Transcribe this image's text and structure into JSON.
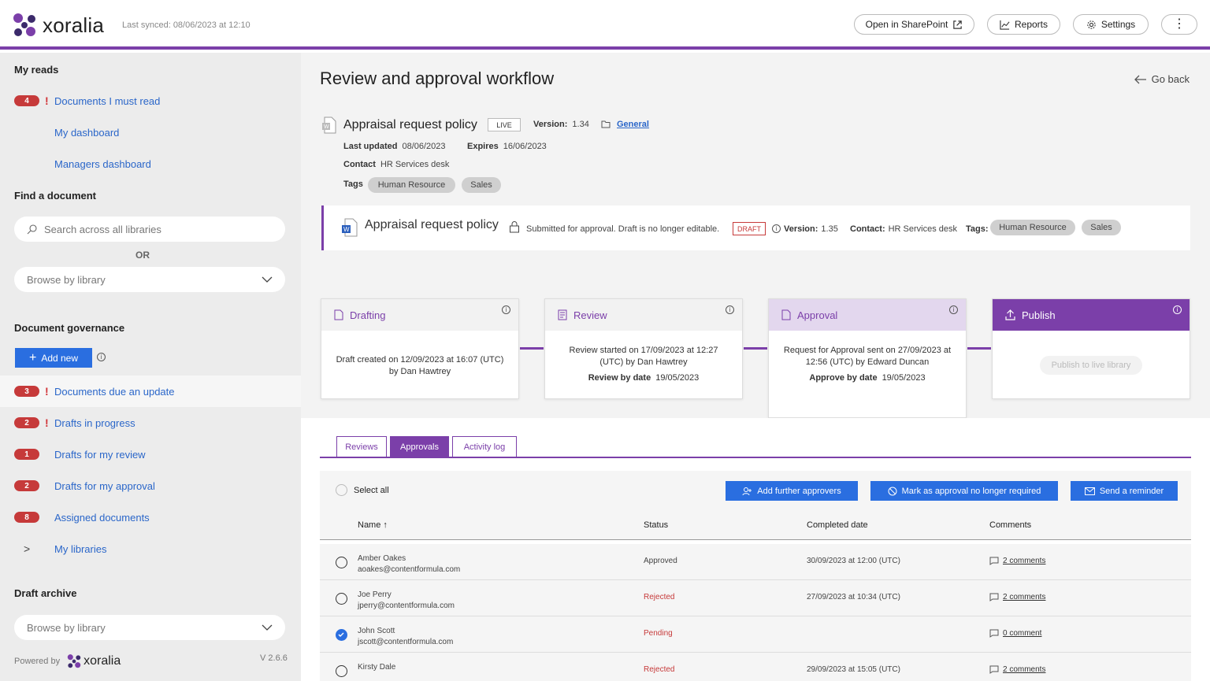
{
  "header": {
    "brand": "xoralia",
    "last_synced": "Last synced: 08/06/2023 at 12:10",
    "open_sharepoint": "Open in SharePoint",
    "reports": "Reports",
    "settings": "Settings"
  },
  "sidebar": {
    "my_reads_title": "My reads",
    "my_reads": [
      {
        "count": "4",
        "urgent": true,
        "label": "Documents I must read"
      },
      {
        "count": "",
        "urgent": false,
        "label": "My dashboard"
      },
      {
        "count": "",
        "urgent": false,
        "label": "Managers dashboard"
      }
    ],
    "find_title": "Find a document",
    "search_placeholder": "Search across all libraries",
    "or_text": "OR",
    "browse_label": "Browse by library",
    "governance_title": "Document governance",
    "add_new": "Add new",
    "governance_items": [
      {
        "count": "3",
        "urgent": true,
        "label": "Documents due an update"
      },
      {
        "count": "2",
        "urgent": true,
        "label": "Drafts in progress"
      },
      {
        "count": "1",
        "urgent": false,
        "label": "Drafts for my review"
      },
      {
        "count": "2",
        "urgent": false,
        "label": "Drafts for my approval"
      },
      {
        "count": "8",
        "urgent": false,
        "label": "Assigned documents"
      },
      {
        "count": "",
        "urgent": false,
        "label": "My libraries"
      }
    ],
    "archive_title": "Draft archive",
    "archive_browse": "Browse by library",
    "powered_by": "Powered by",
    "powered_brand": "xoralia",
    "version": "V 2.6.6"
  },
  "main": {
    "title": "Review and approval workflow",
    "go_back": "Go back",
    "doc": {
      "title": "Appraisal request policy",
      "status": "LIVE",
      "version_label": "Version:",
      "version": "1.34",
      "folder": "General",
      "last_updated_label": "Last updated",
      "last_updated": "08/06/2023",
      "expires_label": "Expires",
      "expires": "16/06/2023",
      "contact_label": "Contact",
      "contact": "HR Services desk",
      "tags_label": "Tags",
      "tags": [
        "Human Resource",
        "Sales"
      ]
    },
    "draft": {
      "title": "Appraisal request policy",
      "note": "Submitted for approval. Draft is no longer editable.",
      "status": "DRAFT",
      "version_label": "Version:",
      "version": "1.35",
      "contact_label": "Contact:",
      "contact": "HR Services desk",
      "tags_label": "Tags:",
      "tags": [
        "Human Resource",
        "Sales"
      ]
    },
    "stages": [
      {
        "title": "Drafting",
        "line1": "Draft created on 12/09/2023 at 16:07 (UTC)",
        "line2": "by Dan Hawtrey",
        "by_label": "",
        "by_date": ""
      },
      {
        "title": "Review",
        "line1": "Review started on 17/09/2023 at 12:27",
        "line2": "(UTC) by Dan Hawtrey",
        "by_label": "Review by date",
        "by_date": "19/05/2023"
      },
      {
        "title": "Approval",
        "line1": "Request for Approval sent on 27/09/2023 at",
        "line2": "12:56 (UTC) by Edward Duncan",
        "by_label": "Approve by date",
        "by_date": "19/05/2023"
      },
      {
        "title": "Publish",
        "button": "Publish to live library"
      }
    ],
    "tabs": [
      "Reviews",
      "Approvals",
      "Activity log"
    ],
    "select_all": "Select all",
    "actions": {
      "add_approvers": "Add  further approvers",
      "mark_not_required": "Mark as approval no longer required",
      "send_reminder": "Send a reminder"
    },
    "columns": [
      "Name ↑",
      "Status",
      "Completed date",
      "Comments"
    ],
    "rows": [
      {
        "name": "Amber Oakes",
        "email": "aoakes@contentformula.com",
        "status": "Approved",
        "date": "30/09/2023 at 12:00 (UTC)",
        "comments": "2 comments",
        "checked": false
      },
      {
        "name": "Joe Perry",
        "email": "jperry@contentformula.com",
        "status": "Rejected",
        "date": "27/09/2023 at 10:34 (UTC)",
        "comments": "2 comments",
        "checked": false
      },
      {
        "name": "John Scott",
        "email": "jscott@contentformula.com",
        "status": "Pending",
        "date": "",
        "comments": "0 comment",
        "checked": true
      },
      {
        "name": "Kirsty Dale",
        "email": "",
        "status": "Rejected",
        "date": "29/09/2023 at 15:05 (UTC)",
        "comments": "2 comments",
        "checked": false
      }
    ]
  },
  "colors": {
    "accent": "#7b3fa9",
    "primary": "#2a6ee0",
    "badge": "#c63a3a",
    "link": "#2a66c9"
  }
}
